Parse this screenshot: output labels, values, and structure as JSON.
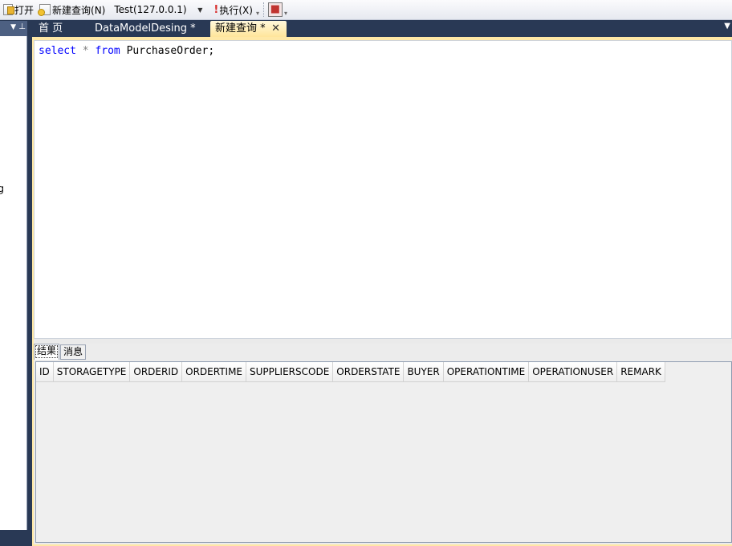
{
  "toolbar": {
    "open_label": "打开",
    "new_query_label": "新建查询(N)",
    "server_value": "Test(127.0.0.1)",
    "execute_label": "执行(X)"
  },
  "left_panel": {
    "clipped_text": "g"
  },
  "tabs": [
    {
      "label": "首 页"
    },
    {
      "label": "DataModelDesing *"
    },
    {
      "label": "新建查询 *",
      "active": true
    }
  ],
  "editor": {
    "query": {
      "kw_select": "select",
      "star": "*",
      "kw_from": "from",
      "table": "PurchaseOrder;"
    }
  },
  "results": {
    "tabs": [
      {
        "label": "结果",
        "active": true
      },
      {
        "label": "消息"
      }
    ],
    "columns": [
      "ID",
      "STORAGETYPE",
      "ORDERID",
      "ORDERTIME",
      "SUPPLIERSCODE",
      "ORDERSTATE",
      "BUYER",
      "OPERATIONTIME",
      "OPERATIONUSER",
      "REMARK"
    ]
  },
  "colors": {
    "frame_bg": "#293955",
    "active_tab": "#ffe59a",
    "keyword": "#0000ff"
  }
}
